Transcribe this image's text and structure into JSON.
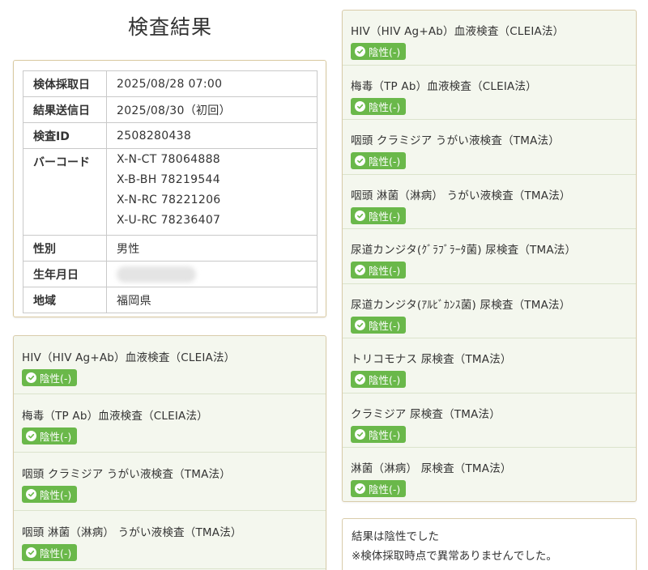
{
  "page": {
    "title": "検査結果"
  },
  "info": {
    "rows": [
      {
        "label": "検体採取日",
        "value": "2025/08/28 07:00"
      },
      {
        "label": "結果送信日",
        "value": "2025/08/30（初回）"
      },
      {
        "label": "検査ID",
        "value": "2508280438"
      }
    ],
    "barcode": {
      "label": "バーコード",
      "codes": [
        "X-N-CT 78064888",
        "X-B-BH 78219544",
        "X-N-RC 78221206",
        "X-U-RC 78236407"
      ]
    },
    "sex": {
      "label": "性別",
      "value": "男性"
    },
    "birthdate": {
      "label": "生年月日"
    },
    "region": {
      "label": "地域",
      "value": "福岡県"
    }
  },
  "left_results": [
    {
      "name": "HIV（HIV Ag+Ab）血液検査（CLEIA法）",
      "result": "陰性(-)"
    },
    {
      "name": "梅毒（TP Ab）血液検査（CLEIA法）",
      "result": "陰性(-)"
    },
    {
      "name": "咽頭 クラミジア うがい液検査（TMA法）",
      "result": "陰性(-)"
    },
    {
      "name": "咽頭 淋菌（淋病） うがい液検査（TMA法）",
      "result": "陰性(-)"
    }
  ],
  "right_results": [
    {
      "name": "HIV（HIV Ag+Ab）血液検査（CLEIA法）",
      "result": "陰性(-)"
    },
    {
      "name": "梅毒（TP Ab）血液検査（CLEIA法）",
      "result": "陰性(-)"
    },
    {
      "name": "咽頭 クラミジア うがい液検査（TMA法）",
      "result": "陰性(-)"
    },
    {
      "name": "咽頭 淋菌（淋病） うがい液検査（TMA法）",
      "result": "陰性(-)"
    },
    {
      "name": "尿道カンジタ(ｸﾞﾗﾌﾞﾗｰﾀ菌) 尿検査（TMA法）",
      "result": "陰性(-)"
    },
    {
      "name": "尿道カンジタ(ｱﾙﾋﾞｶﾝｽ菌) 尿検査（TMA法）",
      "result": "陰性(-)"
    },
    {
      "name": "トリコモナス 尿検査（TMA法）",
      "result": "陰性(-)"
    },
    {
      "name": "クラミジア 尿検査（TMA法）",
      "result": "陰性(-)"
    },
    {
      "name": "淋菌（淋病） 尿検査（TMA法）",
      "result": "陰性(-)"
    }
  ],
  "summary": {
    "line1": "結果は陰性でした",
    "line2": "※検体採取時点で異常ありませんでした。"
  },
  "colors": {
    "badge": "#6ab84a",
    "card_bg": "#f4f7ee",
    "card_border": "#d9ccaa"
  },
  "icons": {
    "badge_icon": "check-circle-icon"
  }
}
